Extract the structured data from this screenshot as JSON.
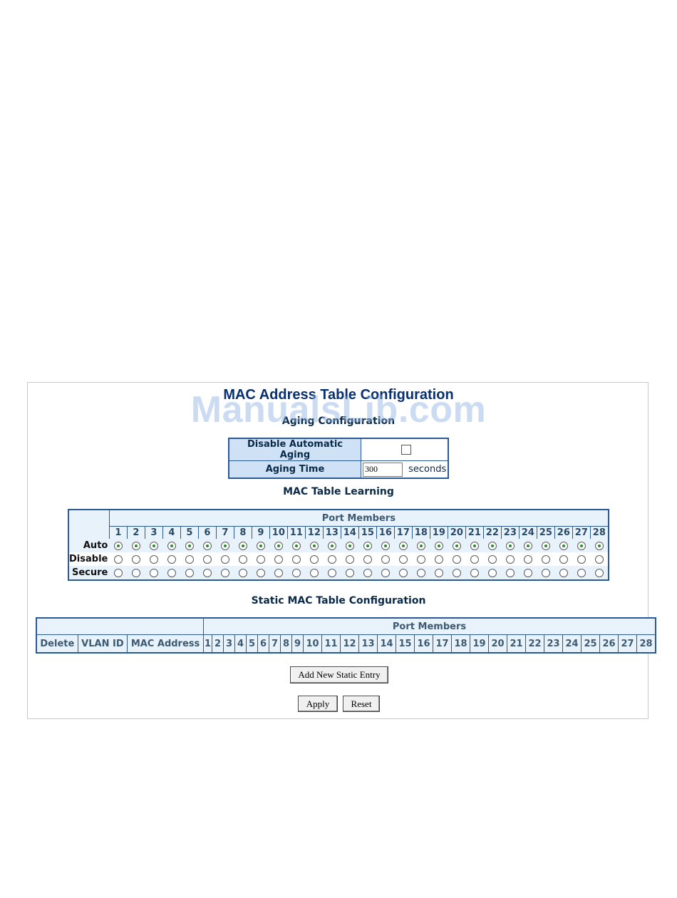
{
  "page_title": "MAC Address Table Configuration",
  "watermark": "ManualsLib.com",
  "aging": {
    "heading": "Aging Configuration",
    "disable_label": "Disable Automatic Aging",
    "time_label": "Aging Time",
    "time_value": "300",
    "time_unit": "seconds",
    "disable_checked": false
  },
  "learning": {
    "heading": "MAC Table Learning",
    "port_header": "Port Members",
    "ports": [
      "1",
      "2",
      "3",
      "4",
      "5",
      "6",
      "7",
      "8",
      "9",
      "10",
      "11",
      "12",
      "13",
      "14",
      "15",
      "16",
      "17",
      "18",
      "19",
      "20",
      "21",
      "22",
      "23",
      "24",
      "25",
      "26",
      "27",
      "28"
    ],
    "modes": [
      "Auto",
      "Disable",
      "Secure"
    ],
    "selected_mode": "Auto"
  },
  "static": {
    "heading": "Static MAC Table Configuration",
    "port_header": "Port Members",
    "columns": [
      "Delete",
      "VLAN ID",
      "MAC Address"
    ],
    "ports": [
      "1",
      "2",
      "3",
      "4",
      "5",
      "6",
      "7",
      "8",
      "9",
      "10",
      "11",
      "12",
      "13",
      "14",
      "15",
      "16",
      "17",
      "18",
      "19",
      "20",
      "21",
      "22",
      "23",
      "24",
      "25",
      "26",
      "27",
      "28"
    ]
  },
  "buttons": {
    "add_entry": "Add New Static Entry",
    "apply": "Apply",
    "reset": "Reset"
  },
  "colors": {
    "table_border": "#2a5a95",
    "header_bg": "#e8f2fb",
    "label_bg": "#cfe2f5",
    "radio_selected": "#2d8a2d"
  }
}
